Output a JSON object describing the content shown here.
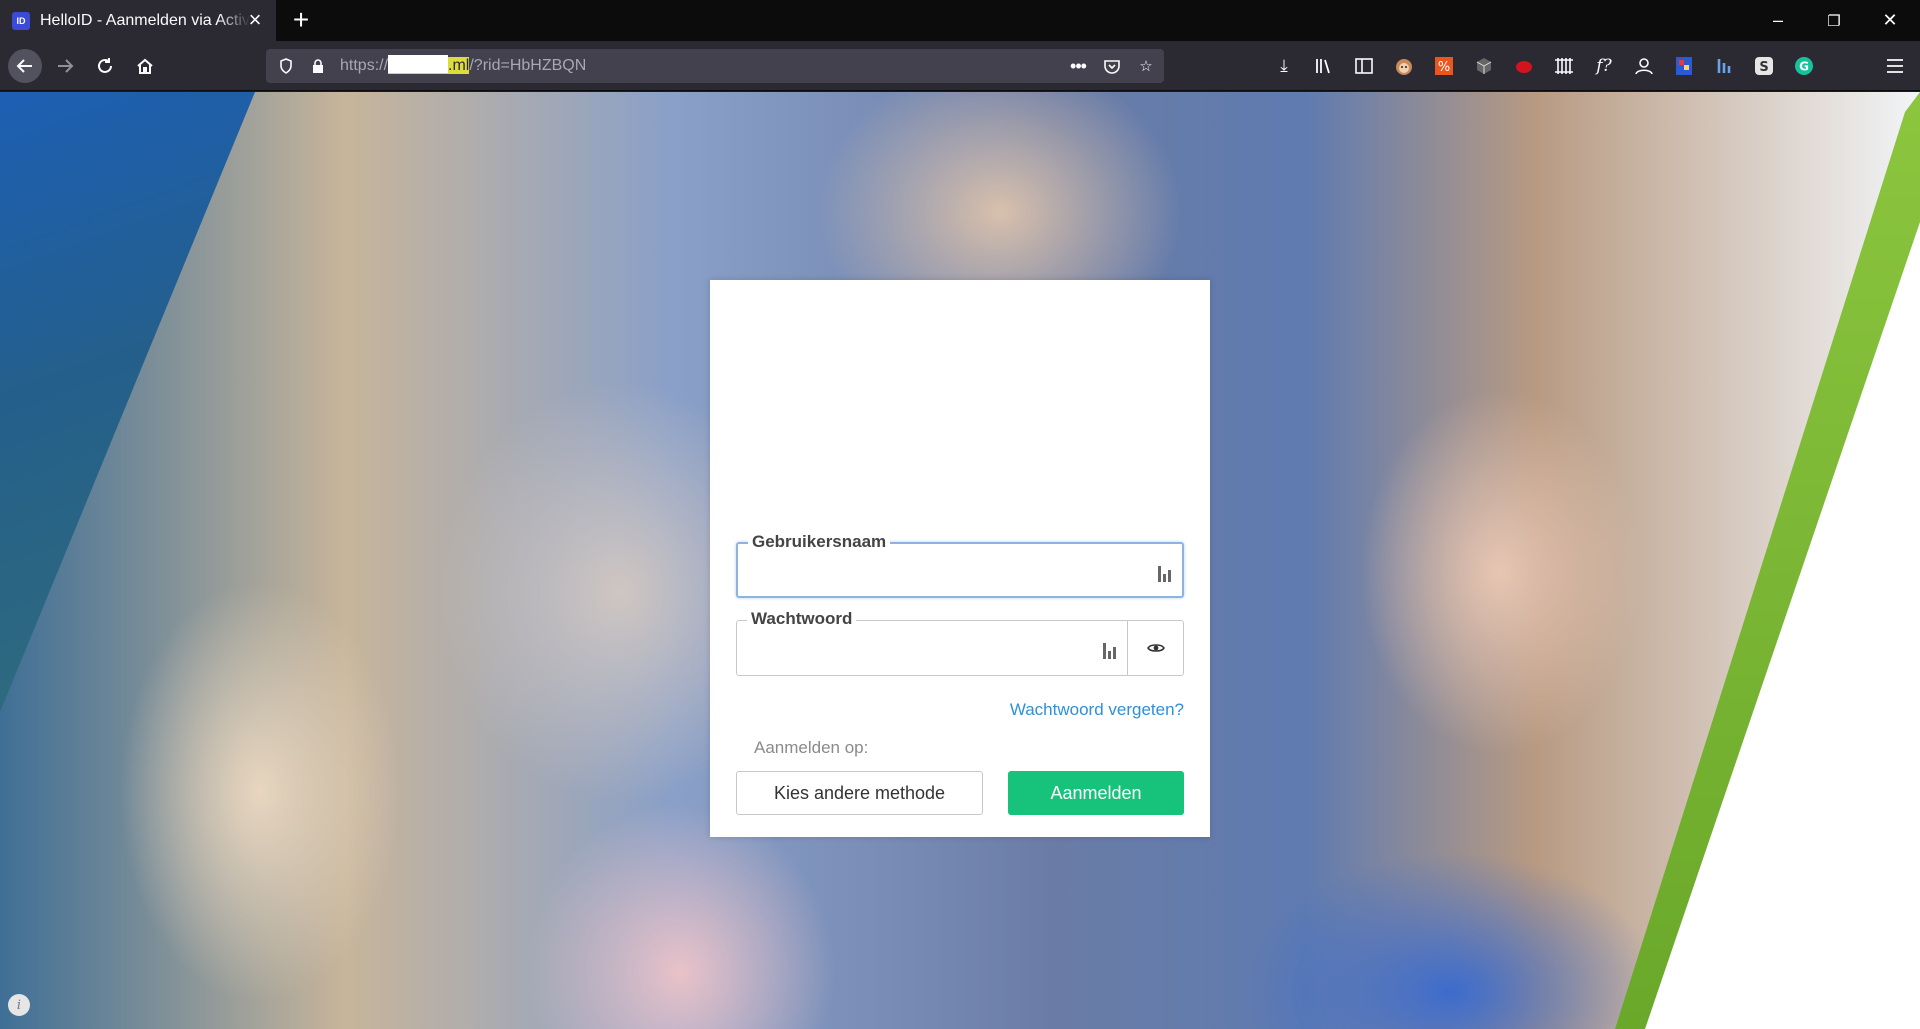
{
  "browser": {
    "tab": {
      "favicon_text": "ID",
      "title": "HelloID - Aanmelden via Active Directory"
    },
    "url": {
      "scheme": "https://",
      "host_suffix": ".ml",
      "path": "/?rid=HbHZBQN"
    }
  },
  "login": {
    "username_label": "Gebruikersnaam",
    "username_value": "",
    "password_label": "Wachtwoord",
    "password_value": "",
    "forgot_password": "Wachtwoord vergeten?",
    "sign_in_on": "Aanmelden op:",
    "other_method_button": "Kies andere methode",
    "submit_button": "Aanmelden"
  },
  "colors": {
    "submit_button": "#17c27a",
    "link": "#2f8fd8",
    "accent_stripe": "#8cc63f"
  },
  "icons": {
    "back": "arrow-left-icon",
    "forward": "arrow-right-icon",
    "reload": "reload-icon",
    "home": "home-icon",
    "password_manager": "password-manager-icon",
    "show_password": "eye-icon"
  }
}
